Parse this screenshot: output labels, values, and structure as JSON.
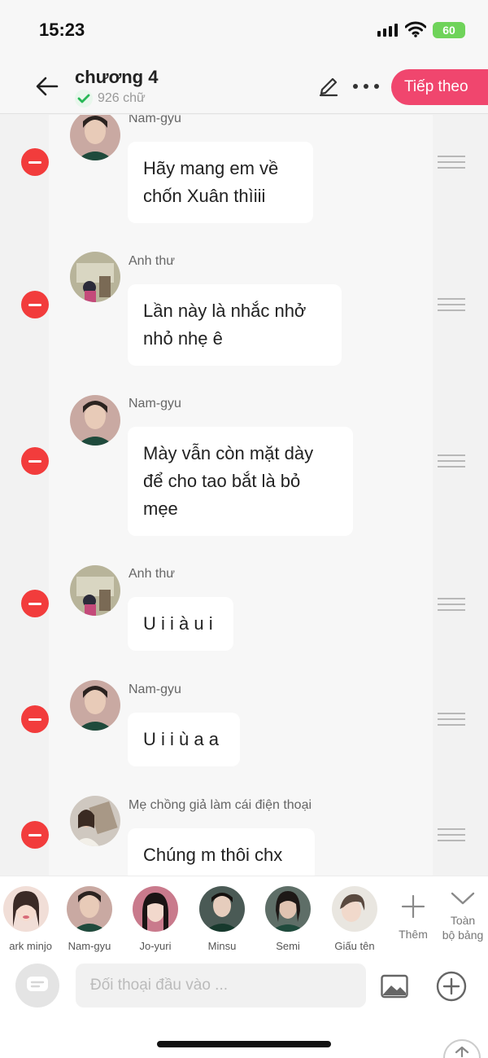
{
  "status_bar": {
    "time": "15:23",
    "battery": "60"
  },
  "header": {
    "title": "chương 4",
    "word_count": "926 chữ",
    "next_label": "Tiếp theo"
  },
  "messages": [
    {
      "name": "Nam-gyu",
      "text": "Hãy mang em về chốn Xuân thìiii"
    },
    {
      "name": "Anh thư",
      "text": "Lần này là nhắc nhở nhỏ nhẹ ê"
    },
    {
      "name": "Nam-gyu",
      "text": "Mày vẫn còn mặt dày để cho tao bắt là bỏ mẹe"
    },
    {
      "name": "Anh thư",
      "text": "U i i à u i"
    },
    {
      "name": "Nam-gyu",
      "text": "U i i ù a a"
    },
    {
      "name": "Mẹ chồng giả làm cái điện thoại",
      "text": "Chúng m thôi chx"
    }
  ],
  "characters": [
    {
      "name": "ark minjo"
    },
    {
      "name": "Nam-gyu"
    },
    {
      "name": "Jo-yuri"
    },
    {
      "name": "Minsu"
    },
    {
      "name": "Semi"
    },
    {
      "name": "Giấu tên"
    }
  ],
  "char_bar": {
    "add_label": "Thêm",
    "all_label_1": "Toàn",
    "all_label_2": "bộ bảng"
  },
  "input": {
    "placeholder": "Đối thoại đầu vào ..."
  },
  "colors": {
    "accent": "#f0466e",
    "delete": "#f23c3c",
    "check": "#27b856"
  },
  "icons": [
    "back-arrow-icon",
    "checkmark-icon",
    "pencil-icon",
    "more-icon",
    "minus-icon",
    "drag-handle-icon",
    "plus-icon",
    "chevron-down-icon",
    "chat-bubble-icon",
    "image-icon",
    "plus-circle-icon",
    "arrow-up-icon"
  ]
}
